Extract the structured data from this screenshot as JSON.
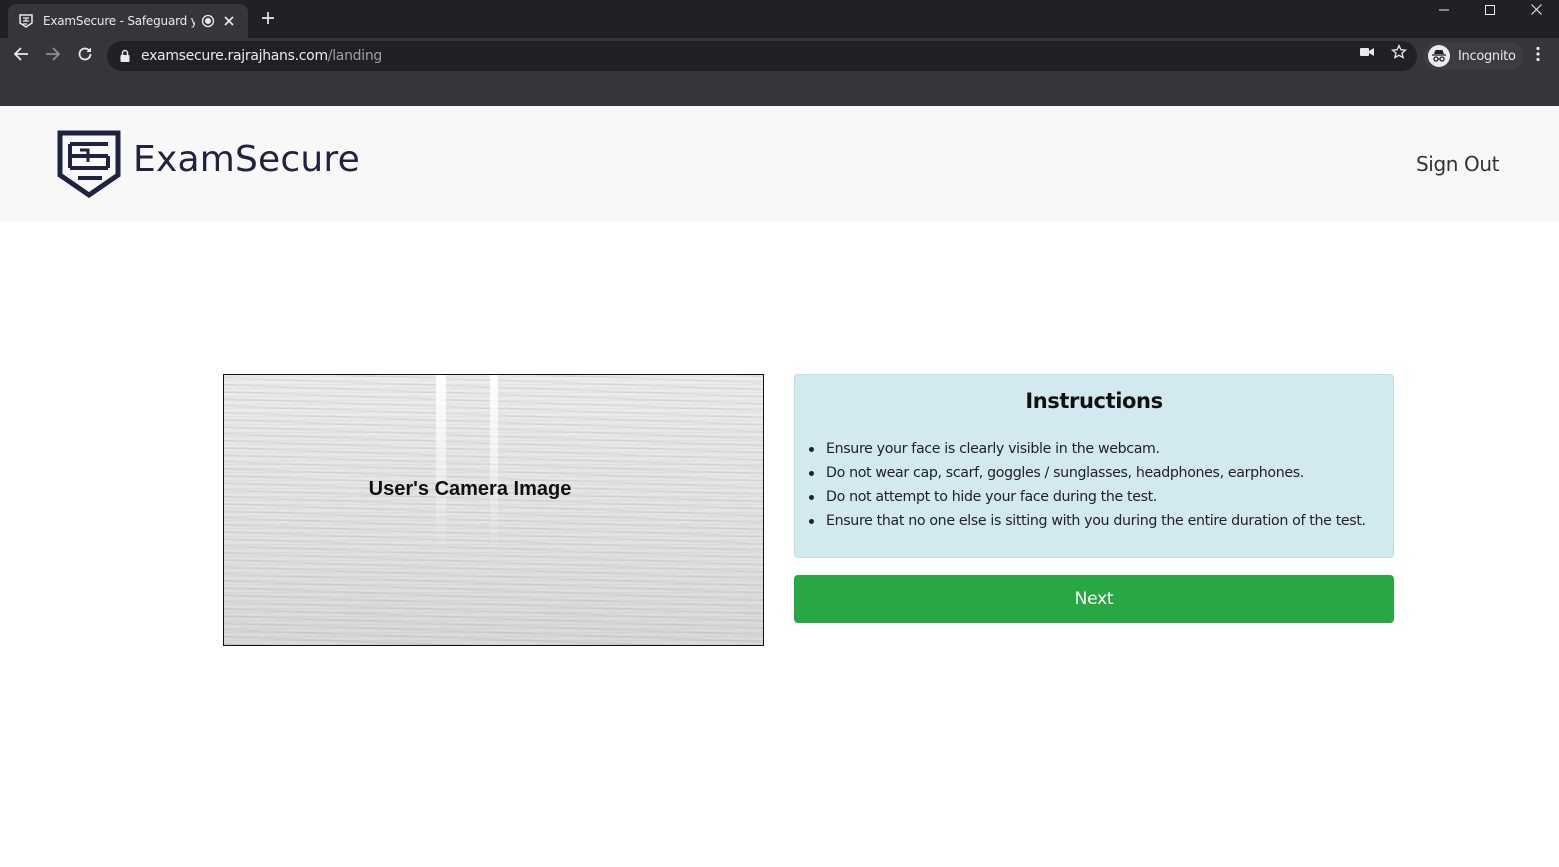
{
  "browser": {
    "tab_title": "ExamSecure - Safeguard you",
    "url_host": "examsecure.rajrajhans.com",
    "url_path": "/landing",
    "profile_label": "Incognito",
    "icons": [
      "shield-favicon",
      "recording-dot-icon",
      "close-icon",
      "plus-icon",
      "minimize-icon",
      "maximize-icon",
      "window-close-icon",
      "back-arrow-icon",
      "forward-arrow-icon",
      "reload-icon",
      "lock-icon",
      "camera-icon",
      "star-icon",
      "incognito-icon",
      "kebab-menu-icon"
    ]
  },
  "header": {
    "brand_name": "ExamSecure",
    "signout_label": "Sign Out"
  },
  "camera": {
    "label": "User's Camera Image"
  },
  "instructions": {
    "title": "Instructions",
    "items": [
      "Ensure your face is clearly visible in the webcam.",
      "Do not wear cap, scarf, goggles / sunglasses, headphones, earphones.",
      "Do not attempt to hide your face during the test.",
      "Ensure that no one else is sitting with you during the entire duration of the test."
    ]
  },
  "actions": {
    "next_label": "Next"
  },
  "colors": {
    "brand_navy": "#1f2340",
    "instructions_bg": "#d1e9ef",
    "next_button": "#28a745",
    "header_bg": "#f8f8f8"
  }
}
